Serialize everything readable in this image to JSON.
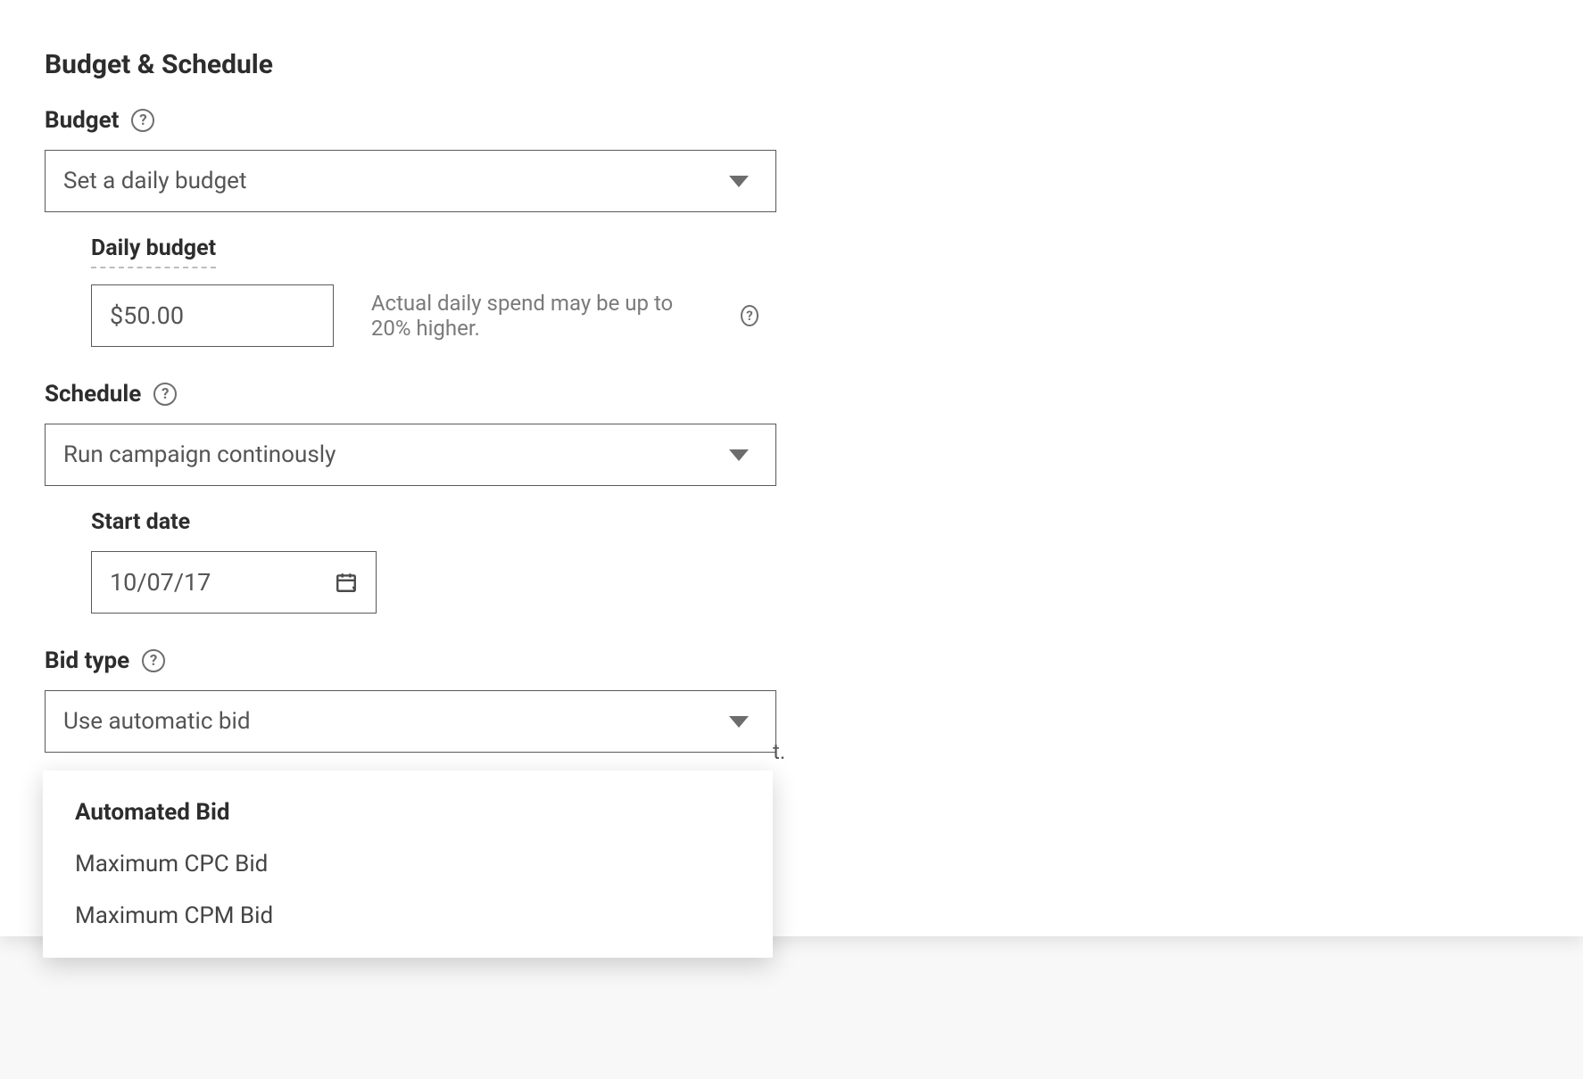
{
  "section_title": "Budget & Schedule",
  "budget": {
    "label": "Budget",
    "select_value": "Set a daily budget",
    "daily_label": "Daily budget",
    "daily_value": "$50.00",
    "hint": "Actual daily spend may be up to 20% higher."
  },
  "schedule": {
    "label": "Schedule",
    "select_value": "Run campaign continously",
    "start_date_label": "Start date",
    "start_date_value": "10/07/17"
  },
  "bid_type": {
    "label": "Bid type",
    "select_value": "Use automatic bid",
    "options": [
      {
        "label": "Automated Bid",
        "selected": true
      },
      {
        "label": "Maximum CPC Bid",
        "selected": false
      },
      {
        "label": "Maximum CPM Bid",
        "selected": false
      }
    ],
    "background_text_fragment": "t."
  }
}
